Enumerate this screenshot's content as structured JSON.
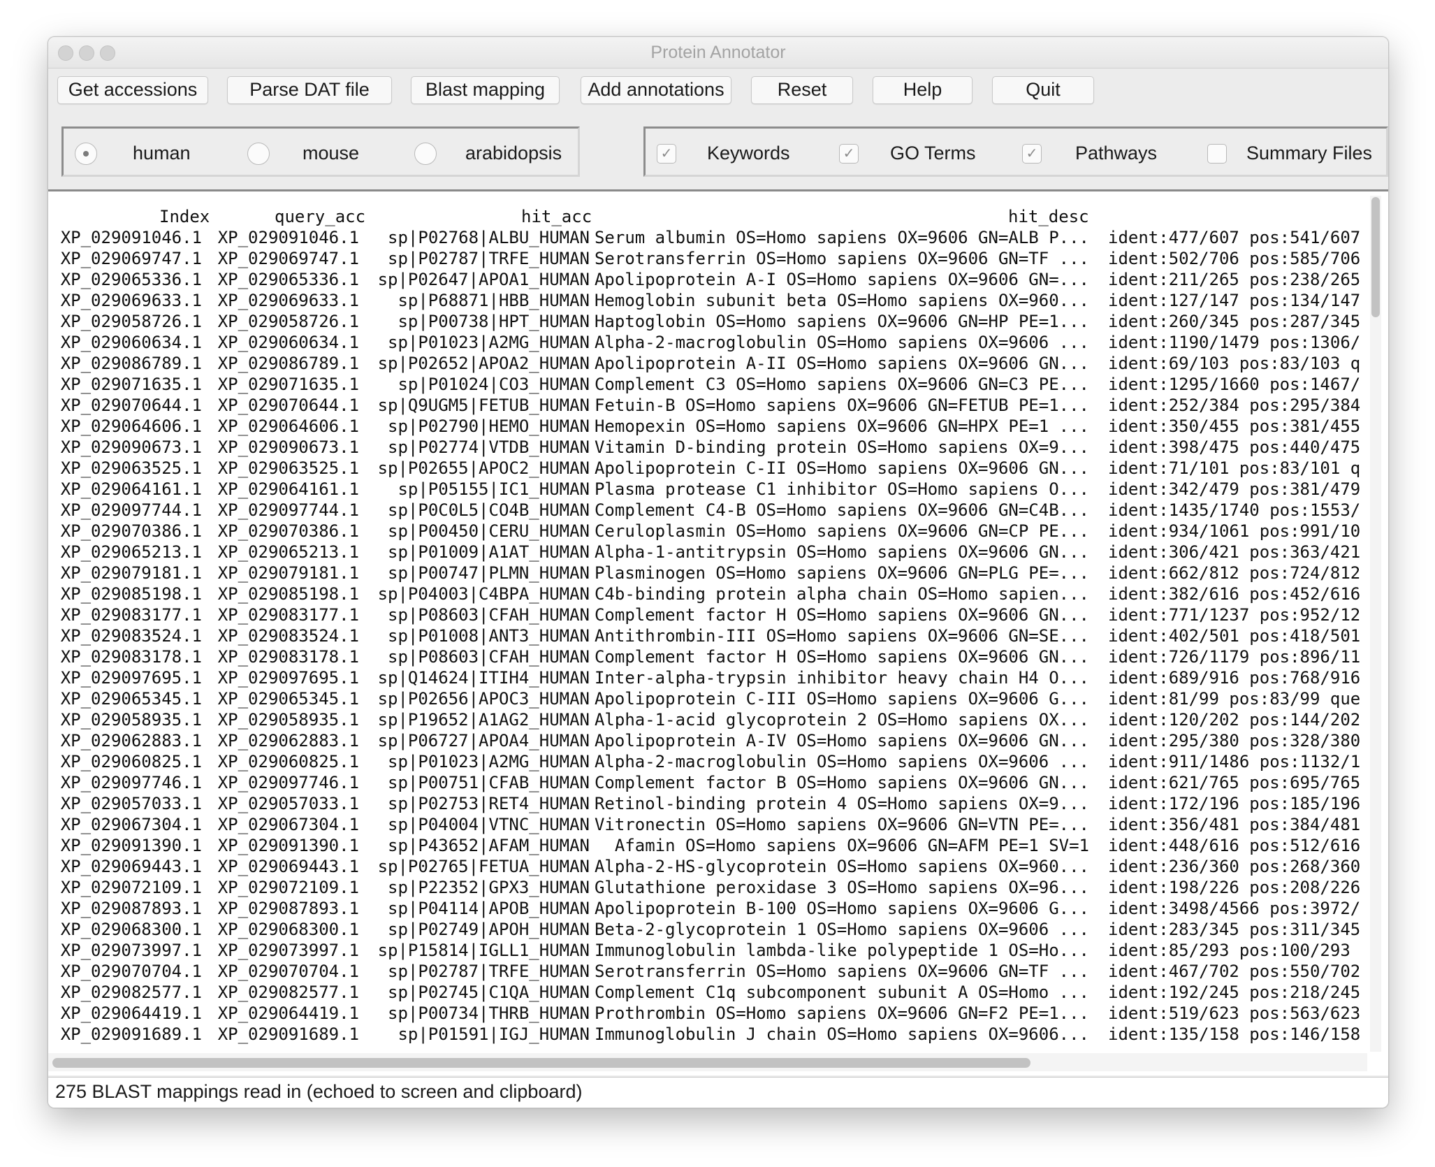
{
  "window": {
    "title": "Protein Annotator"
  },
  "toolbar": {
    "buttons": [
      "Get accessions",
      "Parse DAT file",
      "Blast mapping",
      "Add annotations",
      "Reset",
      "Help",
      "Quit"
    ]
  },
  "species": {
    "options": [
      "human",
      "mouse",
      "arabidopsis"
    ],
    "selected": "human"
  },
  "outputs": {
    "options": [
      {
        "label": "Keywords",
        "checked": true
      },
      {
        "label": "GO Terms",
        "checked": true
      },
      {
        "label": "Pathways",
        "checked": true
      },
      {
        "label": "Summary Files",
        "checked": false
      }
    ]
  },
  "table": {
    "columns": [
      "Index",
      "query_acc",
      "hit_acc",
      "hit_desc"
    ],
    "rows": [
      [
        "XP_029091046.1",
        "XP_029091046.1",
        "sp|P02768|ALBU_HUMAN",
        "Serum albumin OS=Homo sapiens OX=9606 GN=ALB P...",
        "ident:477/607 pos:541/607"
      ],
      [
        "XP_029069747.1",
        "XP_029069747.1",
        "sp|P02787|TRFE_HUMAN",
        "Serotransferrin OS=Homo sapiens OX=9606 GN=TF ...",
        "ident:502/706 pos:585/706"
      ],
      [
        "XP_029065336.1",
        "XP_029065336.1",
        "sp|P02647|APOA1_HUMAN",
        "Apolipoprotein A-I OS=Homo sapiens OX=9606 GN=...",
        "ident:211/265 pos:238/265"
      ],
      [
        "XP_029069633.1",
        "XP_029069633.1",
        "sp|P68871|HBB_HUMAN",
        "Hemoglobin subunit beta OS=Homo sapiens OX=960...",
        "ident:127/147 pos:134/147"
      ],
      [
        "XP_029058726.1",
        "XP_029058726.1",
        "sp|P00738|HPT_HUMAN",
        "Haptoglobin OS=Homo sapiens OX=9606 GN=HP PE=1...",
        "ident:260/345 pos:287/345"
      ],
      [
        "XP_029060634.1",
        "XP_029060634.1",
        "sp|P01023|A2MG_HUMAN",
        "Alpha-2-macroglobulin OS=Homo sapiens OX=9606 ...",
        "ident:1190/1479 pos:1306/"
      ],
      [
        "XP_029086789.1",
        "XP_029086789.1",
        "sp|P02652|APOA2_HUMAN",
        "Apolipoprotein A-II OS=Homo sapiens OX=9606 GN...",
        "ident:69/103 pos:83/103 q"
      ],
      [
        "XP_029071635.1",
        "XP_029071635.1",
        "sp|P01024|CO3_HUMAN",
        "Complement C3 OS=Homo sapiens OX=9606 GN=C3 PE...",
        "ident:1295/1660 pos:1467/"
      ],
      [
        "XP_029070644.1",
        "XP_029070644.1",
        "sp|Q9UGM5|FETUB_HUMAN",
        "Fetuin-B OS=Homo sapiens OX=9606 GN=FETUB PE=1...",
        "ident:252/384 pos:295/384"
      ],
      [
        "XP_029064606.1",
        "XP_029064606.1",
        "sp|P02790|HEMO_HUMAN",
        "Hemopexin OS=Homo sapiens OX=9606 GN=HPX PE=1 ...",
        "ident:350/455 pos:381/455"
      ],
      [
        "XP_029090673.1",
        "XP_029090673.1",
        "sp|P02774|VTDB_HUMAN",
        "Vitamin D-binding protein OS=Homo sapiens OX=9...",
        "ident:398/475 pos:440/475"
      ],
      [
        "XP_029063525.1",
        "XP_029063525.1",
        "sp|P02655|APOC2_HUMAN",
        "Apolipoprotein C-II OS=Homo sapiens OX=9606 GN...",
        "ident:71/101 pos:83/101 q"
      ],
      [
        "XP_029064161.1",
        "XP_029064161.1",
        "sp|P05155|IC1_HUMAN",
        "Plasma protease C1 inhibitor OS=Homo sapiens O...",
        "ident:342/479 pos:381/479"
      ],
      [
        "XP_029097744.1",
        "XP_029097744.1",
        "sp|P0C0L5|CO4B_HUMAN",
        "Complement C4-B OS=Homo sapiens OX=9606 GN=C4B...",
        "ident:1435/1740 pos:1553/"
      ],
      [
        "XP_029070386.1",
        "XP_029070386.1",
        "sp|P00450|CERU_HUMAN",
        "Ceruloplasmin OS=Homo sapiens OX=9606 GN=CP PE...",
        "ident:934/1061 pos:991/10"
      ],
      [
        "XP_029065213.1",
        "XP_029065213.1",
        "sp|P01009|A1AT_HUMAN",
        "Alpha-1-antitrypsin OS=Homo sapiens OX=9606 GN...",
        "ident:306/421 pos:363/421"
      ],
      [
        "XP_029079181.1",
        "XP_029079181.1",
        "sp|P00747|PLMN_HUMAN",
        "Plasminogen OS=Homo sapiens OX=9606 GN=PLG PE=...",
        "ident:662/812 pos:724/812"
      ],
      [
        "XP_029085198.1",
        "XP_029085198.1",
        "sp|P04003|C4BPA_HUMAN",
        "C4b-binding protein alpha chain OS=Homo sapien...",
        "ident:382/616 pos:452/616"
      ],
      [
        "XP_029083177.1",
        "XP_029083177.1",
        "sp|P08603|CFAH_HUMAN",
        "Complement factor H OS=Homo sapiens OX=9606 GN...",
        "ident:771/1237 pos:952/12"
      ],
      [
        "XP_029083524.1",
        "XP_029083524.1",
        "sp|P01008|ANT3_HUMAN",
        "Antithrombin-III OS=Homo sapiens OX=9606 GN=SE...",
        "ident:402/501 pos:418/501"
      ],
      [
        "XP_029083178.1",
        "XP_029083178.1",
        "sp|P08603|CFAH_HUMAN",
        "Complement factor H OS=Homo sapiens OX=9606 GN...",
        "ident:726/1179 pos:896/11"
      ],
      [
        "XP_029097695.1",
        "XP_029097695.1",
        "sp|Q14624|ITIH4_HUMAN",
        "Inter-alpha-trypsin inhibitor heavy chain H4 O...",
        "ident:689/916 pos:768/916"
      ],
      [
        "XP_029065345.1",
        "XP_029065345.1",
        "sp|P02656|APOC3_HUMAN",
        "Apolipoprotein C-III OS=Homo sapiens OX=9606 G...",
        "ident:81/99 pos:83/99 que"
      ],
      [
        "XP_029058935.1",
        "XP_029058935.1",
        "sp|P19652|A1AG2_HUMAN",
        "Alpha-1-acid glycoprotein 2 OS=Homo sapiens OX...",
        "ident:120/202 pos:144/202"
      ],
      [
        "XP_029062883.1",
        "XP_029062883.1",
        "sp|P06727|APOA4_HUMAN",
        "Apolipoprotein A-IV OS=Homo sapiens OX=9606 GN...",
        "ident:295/380 pos:328/380"
      ],
      [
        "XP_029060825.1",
        "XP_029060825.1",
        "sp|P01023|A2MG_HUMAN",
        "Alpha-2-macroglobulin OS=Homo sapiens OX=9606 ...",
        "ident:911/1486 pos:1132/1"
      ],
      [
        "XP_029097746.1",
        "XP_029097746.1",
        "sp|P00751|CFAB_HUMAN",
        "Complement factor B OS=Homo sapiens OX=9606 GN...",
        "ident:621/765 pos:695/765"
      ],
      [
        "XP_029057033.1",
        "XP_029057033.1",
        "sp|P02753|RET4_HUMAN",
        "Retinol-binding protein 4 OS=Homo sapiens OX=9...",
        "ident:172/196 pos:185/196"
      ],
      [
        "XP_029067304.1",
        "XP_029067304.1",
        "sp|P04004|VTNC_HUMAN",
        "Vitronectin OS=Homo sapiens OX=9606 GN=VTN PE=...",
        "ident:356/481 pos:384/481"
      ],
      [
        "XP_029091390.1",
        "XP_029091390.1",
        "sp|P43652|AFAM_HUMAN",
        "Afamin OS=Homo sapiens OX=9606 GN=AFM PE=1 SV=1",
        "ident:448/616 pos:512/616"
      ],
      [
        "XP_029069443.1",
        "XP_029069443.1",
        "sp|P02765|FETUA_HUMAN",
        "Alpha-2-HS-glycoprotein OS=Homo sapiens OX=960...",
        "ident:236/360 pos:268/360"
      ],
      [
        "XP_029072109.1",
        "XP_029072109.1",
        "sp|P22352|GPX3_HUMAN",
        "Glutathione peroxidase 3 OS=Homo sapiens OX=96...",
        "ident:198/226 pos:208/226"
      ],
      [
        "XP_029087893.1",
        "XP_029087893.1",
        "sp|P04114|APOB_HUMAN",
        "Apolipoprotein B-100 OS=Homo sapiens OX=9606 G...",
        "ident:3498/4566 pos:3972/"
      ],
      [
        "XP_029068300.1",
        "XP_029068300.1",
        "sp|P02749|APOH_HUMAN",
        "Beta-2-glycoprotein 1 OS=Homo sapiens OX=9606 ...",
        "ident:283/345 pos:311/345"
      ],
      [
        "XP_029073997.1",
        "XP_029073997.1",
        "sp|P15814|IGLL1_HUMAN",
        "Immunoglobulin lambda-like polypeptide 1 OS=Ho...",
        "ident:85/293 pos:100/293"
      ],
      [
        "XP_029070704.1",
        "XP_029070704.1",
        "sp|P02787|TRFE_HUMAN",
        "Serotransferrin OS=Homo sapiens OX=9606 GN=TF ...",
        "ident:467/702 pos:550/702"
      ],
      [
        "XP_029082577.1",
        "XP_029082577.1",
        "sp|P02745|C1QA_HUMAN",
        "Complement C1q subcomponent subunit A OS=Homo ...",
        "ident:192/245 pos:218/245"
      ],
      [
        "XP_029064419.1",
        "XP_029064419.1",
        "sp|P00734|THRB_HUMAN",
        "Prothrombin OS=Homo sapiens OX=9606 GN=F2 PE=1...",
        "ident:519/623 pos:563/623"
      ],
      [
        "XP_029091689.1",
        "XP_029091689.1",
        "sp|P01591|IGJ_HUMAN",
        "Immunoglobulin J chain OS=Homo sapiens OX=9606...",
        "ident:135/158 pos:146/158"
      ]
    ]
  },
  "status": {
    "text": "275 BLAST mappings read in (echoed to screen and clipboard)"
  }
}
